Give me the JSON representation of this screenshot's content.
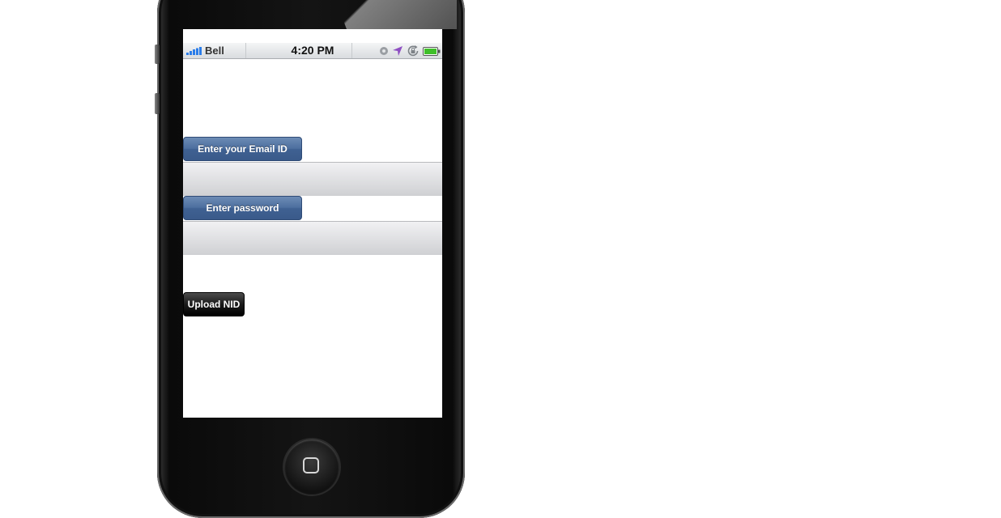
{
  "status_bar": {
    "carrier": "Bell",
    "time": "4:20 PM"
  },
  "form": {
    "email_label": "Enter your Email ID",
    "email_value": "",
    "password_label": "Enter password",
    "password_value": "",
    "upload_label": "Upload NID"
  },
  "icons": {
    "signal": "signal-bars-icon",
    "activity": "activity-icon",
    "location": "location-arrow-icon",
    "rotation_lock": "rotation-lock-icon",
    "battery": "battery-icon"
  },
  "colors": {
    "label_button": "#4d6f9f",
    "upload_button": "#1a1a1a",
    "signal_blue": "#2b7de9",
    "location_purple": "#8e4fc2",
    "battery_green": "#3fbf2a"
  }
}
